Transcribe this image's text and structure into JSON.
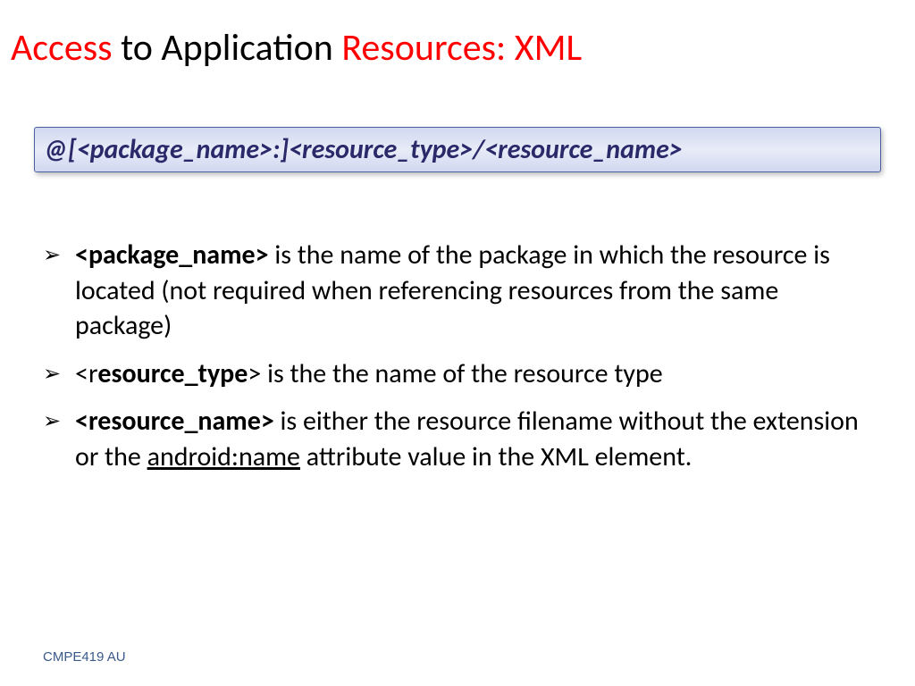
{
  "title": {
    "part1": "Access",
    "part2": " to Application ",
    "part3": "Resources: XML"
  },
  "syntax": "@[<package_name>:]<resource_type>/<resource_name>",
  "bullets": [
    {
      "bold": "<package_name>",
      "rest": " is the name of the package in which the resource is located (not required when referencing resources from the same package)"
    },
    {
      "prefix": "<r",
      "bold": "esource_type",
      "suffix": ">",
      "rest": " is the the name of the resource type"
    },
    {
      "bold": "<resource_name>",
      "rest1": " is either the resource filename without the extension or the ",
      "underline": "android:name",
      "rest2": " attribute value in the XML element."
    }
  ],
  "footer": "CMPE419 AU",
  "marker": "➢"
}
